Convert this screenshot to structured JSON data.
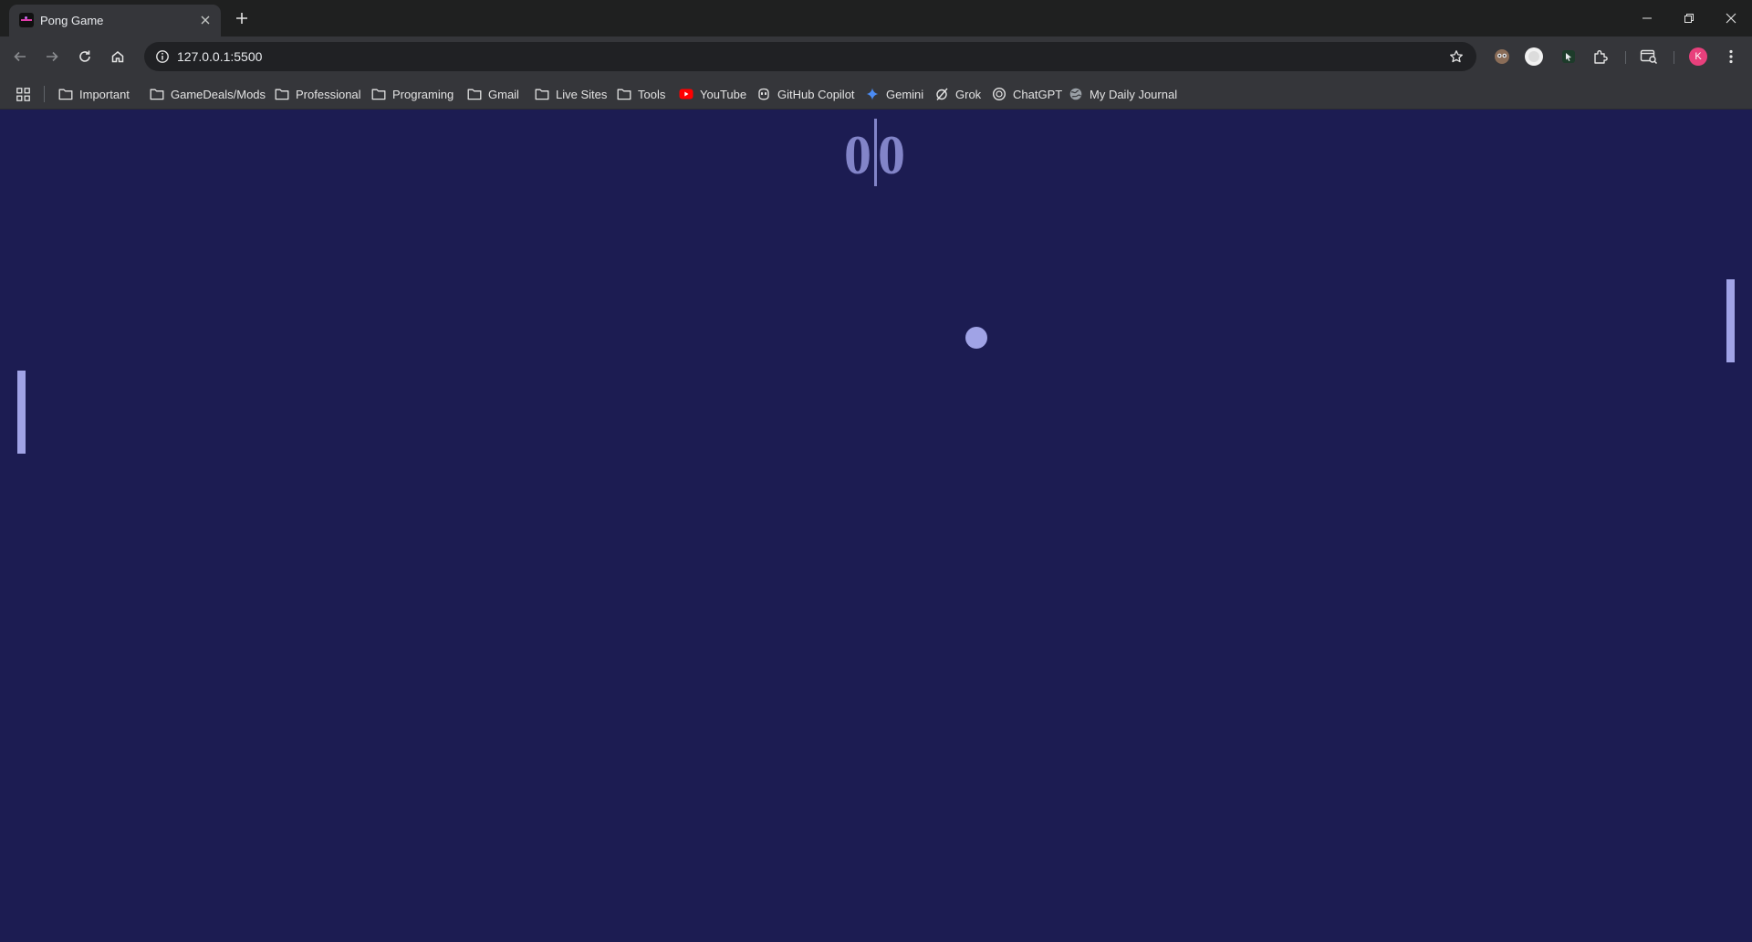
{
  "browser": {
    "tab": {
      "title": "Pong Game",
      "close_icon": "close-icon"
    },
    "new_tab_icon": "plus-icon",
    "window_controls": [
      "minimize-icon",
      "restore-icon",
      "close-icon"
    ],
    "url": "127.0.0.1:5500",
    "profile_initial": "K",
    "accent_colors": {
      "profile": "#e8407c",
      "youtube": "#ff0000",
      "gemini": "#4b8cf5"
    }
  },
  "bookmarks": [
    {
      "label": "Important",
      "icon": "folder-icon"
    },
    {
      "label": "GameDeals/Mods",
      "icon": "folder-icon"
    },
    {
      "label": "Professional",
      "icon": "folder-icon"
    },
    {
      "label": "Programing",
      "icon": "folder-icon"
    },
    {
      "label": "Gmail",
      "icon": "folder-icon"
    },
    {
      "label": "Live Sites",
      "icon": "folder-icon"
    },
    {
      "label": "Tools",
      "icon": "folder-icon"
    },
    {
      "label": "YouTube",
      "icon": "youtube-icon"
    },
    {
      "label": "GitHub Copilot",
      "icon": "copilot-icon"
    },
    {
      "label": "Gemini",
      "icon": "gemini-icon"
    },
    {
      "label": "Grok",
      "icon": "grok-icon"
    },
    {
      "label": "ChatGPT",
      "icon": "chatgpt-icon"
    },
    {
      "label": "My Daily Journal",
      "icon": "globe-icon"
    }
  ],
  "game": {
    "score_left": "0",
    "score_right": "0",
    "colors": {
      "background": "#1c1c52",
      "score": "#8284c8",
      "paddle": "#a0a3e6",
      "ball": "#a0a3e6"
    }
  }
}
